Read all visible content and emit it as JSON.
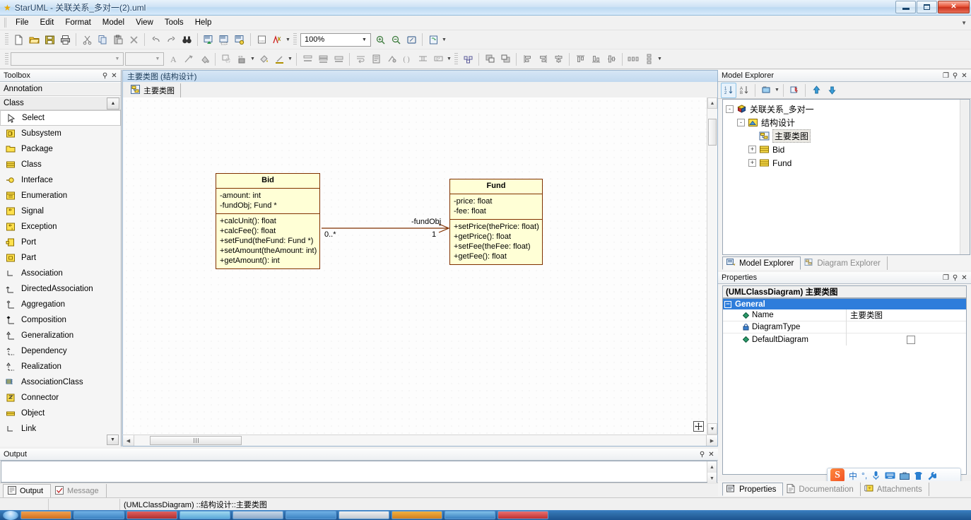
{
  "window": {
    "title": "StarUML - 关联关系_多对一(2).uml",
    "app_icon": "star-icon",
    "minimize": "—",
    "maximize": "□",
    "close": "✕"
  },
  "menu": {
    "items": [
      {
        "label": "File"
      },
      {
        "label": "Edit"
      },
      {
        "label": "Format"
      },
      {
        "label": "Model"
      },
      {
        "label": "View"
      },
      {
        "label": "Tools"
      },
      {
        "label": "Help"
      }
    ]
  },
  "toolbar_main": {
    "zoom_level": "100%",
    "buttons": [
      "new-file-icon",
      "open-folder-icon",
      "save-disk-icon",
      "print-icon",
      "cut-scissors-icon",
      "copy-icon",
      "paste-icon",
      "delete-x-icon",
      "undo-icon",
      "redo-icon",
      "find-binoculars-icon",
      "add-diagram-icon",
      "add-model-icon",
      "add-view-icon",
      "generate-code-icon",
      "validate-icon"
    ],
    "zoom_buttons": [
      "zoom-in-icon",
      "zoom-out-icon",
      "fit-window-icon",
      "refresh-icon"
    ]
  },
  "toolbar_format": {
    "font_combo_value": "",
    "size_combo_value": "",
    "buttons": [
      "font-style-icon",
      "line-style-icon",
      "fill-color-icon",
      "shape-style-icon",
      "stereotype-icon",
      "fill-icon",
      "line-color-icon",
      "suppress-attr-icon",
      "suppress-oper-icon",
      "suppress-both-icon",
      "word-wrap-icon",
      "show-property-icon",
      "show-visibility-icon",
      "show-parameter-icon",
      "show-type-icon",
      "show-multiplicity-icon",
      "auto-resize-icon",
      "bring-front-icon",
      "send-back-icon",
      "align-left-icon",
      "align-right-icon",
      "align-center-icon",
      "align-top-icon",
      "align-bottom-icon",
      "align-middle-icon",
      "space-horizontal-icon",
      "space-vertical-icon"
    ]
  },
  "toolbox": {
    "title": "Toolbox",
    "groups": [
      {
        "label": "Annotation"
      },
      {
        "label": "Class"
      }
    ],
    "items": [
      {
        "label": "Select",
        "icon": "cursor-arrow-icon",
        "selected": true
      },
      {
        "label": "Subsystem",
        "icon": "subsystem-icon",
        "selected": false
      },
      {
        "label": "Package",
        "icon": "package-folder-icon",
        "selected": false
      },
      {
        "label": "Class",
        "icon": "class-box-icon",
        "selected": false
      },
      {
        "label": "Interface",
        "icon": "interface-lollipop-icon",
        "selected": false
      },
      {
        "label": "Enumeration",
        "icon": "enumeration-icon",
        "selected": false
      },
      {
        "label": "Signal",
        "icon": "signal-icon",
        "selected": false
      },
      {
        "label": "Exception",
        "icon": "exception-icon",
        "selected": false
      },
      {
        "label": "Port",
        "icon": "port-icon",
        "selected": false
      },
      {
        "label": "Part",
        "icon": "part-icon",
        "selected": false
      },
      {
        "label": "Association",
        "icon": "association-line-icon",
        "selected": false
      },
      {
        "label": "DirectedAssociation",
        "icon": "directed-association-icon",
        "selected": false
      },
      {
        "label": "Aggregation",
        "icon": "aggregation-diamond-icon",
        "selected": false
      },
      {
        "label": "Composition",
        "icon": "composition-diamond-icon",
        "selected": false
      },
      {
        "label": "Generalization",
        "icon": "generalization-arrow-icon",
        "selected": false
      },
      {
        "label": "Dependency",
        "icon": "dependency-dashed-icon",
        "selected": false
      },
      {
        "label": "Realization",
        "icon": "realization-dashed-icon",
        "selected": false
      },
      {
        "label": "AssociationClass",
        "icon": "association-class-icon",
        "selected": false
      },
      {
        "label": "Connector",
        "icon": "connector-icon",
        "selected": false
      },
      {
        "label": "Object",
        "icon": "object-icon",
        "selected": false
      },
      {
        "label": "Link",
        "icon": "link-icon",
        "selected": false
      }
    ]
  },
  "editor": {
    "header_title": "主要类图 (结构设计)",
    "tab_label": "主要类图",
    "tab_icon": "class-diagram-icon"
  },
  "diagram": {
    "classes": [
      {
        "name": "Bid",
        "attributes": [
          "-amount: int",
          "-fundObj; Fund *"
        ],
        "operations": [
          "+calcUnit(): float",
          "+calcFee(): float",
          "+setFund(theFund: Fund *)",
          "+setAmount(theAmount: int)",
          "+getAmount(): int"
        ]
      },
      {
        "name": "Fund",
        "attributes": [
          "-price: float",
          "-fee: float"
        ],
        "operations": [
          "+setPrice(thePrice: float)",
          "+getPrice(): float",
          "+setFee(theFee: float)",
          "+getFee(): float"
        ]
      }
    ],
    "association": {
      "role_label": "-fundObj",
      "source_multiplicity": "0..*",
      "target_multiplicity": "1",
      "type": "directed-association"
    },
    "pan_icon": "pan-move-icon"
  },
  "model_explorer": {
    "title": "Model Explorer",
    "toolbar_icons": [
      "sort-numeric-icon",
      "sort-alpha-icon",
      "filter-icon",
      "refresh-model-icon",
      "move-up-icon",
      "move-down-icon"
    ],
    "tree": [
      {
        "label": "关联关系_多对一",
        "icon": "project-cube-icon",
        "depth": 0,
        "expander": "-",
        "selected": false
      },
      {
        "label": "结构设计",
        "icon": "model-icon",
        "depth": 1,
        "expander": "-",
        "selected": false
      },
      {
        "label": "主要类图",
        "icon": "class-diagram-icon",
        "depth": 2,
        "expander": "",
        "selected": true
      },
      {
        "label": "Bid",
        "icon": "class-box-icon",
        "depth": 2,
        "expander": "+",
        "selected": false
      },
      {
        "label": "Fund",
        "icon": "class-box-icon",
        "depth": 2,
        "expander": "+",
        "selected": false
      }
    ],
    "tabs": [
      {
        "label": "Model Explorer",
        "icon": "model-explorer-icon",
        "active": true
      },
      {
        "label": "Diagram Explorer",
        "icon": "diagram-explorer-icon",
        "active": false
      }
    ]
  },
  "properties": {
    "title": "Properties",
    "subject": "(UMLClassDiagram) 主要类图",
    "group_label": "General",
    "rows": [
      {
        "key": "Name",
        "value": "主要类图",
        "mark": "diamond",
        "type": "text"
      },
      {
        "key": "DiagramType",
        "value": "",
        "mark": "lock",
        "type": "text"
      },
      {
        "key": "DefaultDiagram",
        "value": "",
        "mark": "diamond",
        "type": "checkbox",
        "checked": false
      }
    ],
    "tabs": [
      {
        "label": "Properties",
        "icon": "properties-icon",
        "active": true
      },
      {
        "label": "Documentation",
        "icon": "documentation-icon",
        "active": false
      },
      {
        "label": "Attachments",
        "icon": "attachments-icon",
        "active": false
      }
    ]
  },
  "output": {
    "title": "Output",
    "content": "",
    "tabs": [
      {
        "label": "Output",
        "icon": "output-icon",
        "active": true
      },
      {
        "label": "Message",
        "icon": "message-check-icon",
        "active": false
      }
    ]
  },
  "statusbar": {
    "cell1": "",
    "cell2": "",
    "path": "(UMLClassDiagram) ::结构设计::主要类图"
  },
  "ime": {
    "logo": "S",
    "items": [
      "中",
      "°,",
      "mic-icon",
      "keyboard-icon",
      "toolbox-icon",
      "skin-icon",
      "wrench-icon"
    ]
  },
  "panel_buttons": {
    "float": "❐",
    "pin": "⚲",
    "close": "✕"
  },
  "colors": {
    "uml_fill": "#ffffd6",
    "uml_border": "#803000",
    "accent_blue": "#2e7ddb",
    "title_bar": "#cfe3f5"
  }
}
